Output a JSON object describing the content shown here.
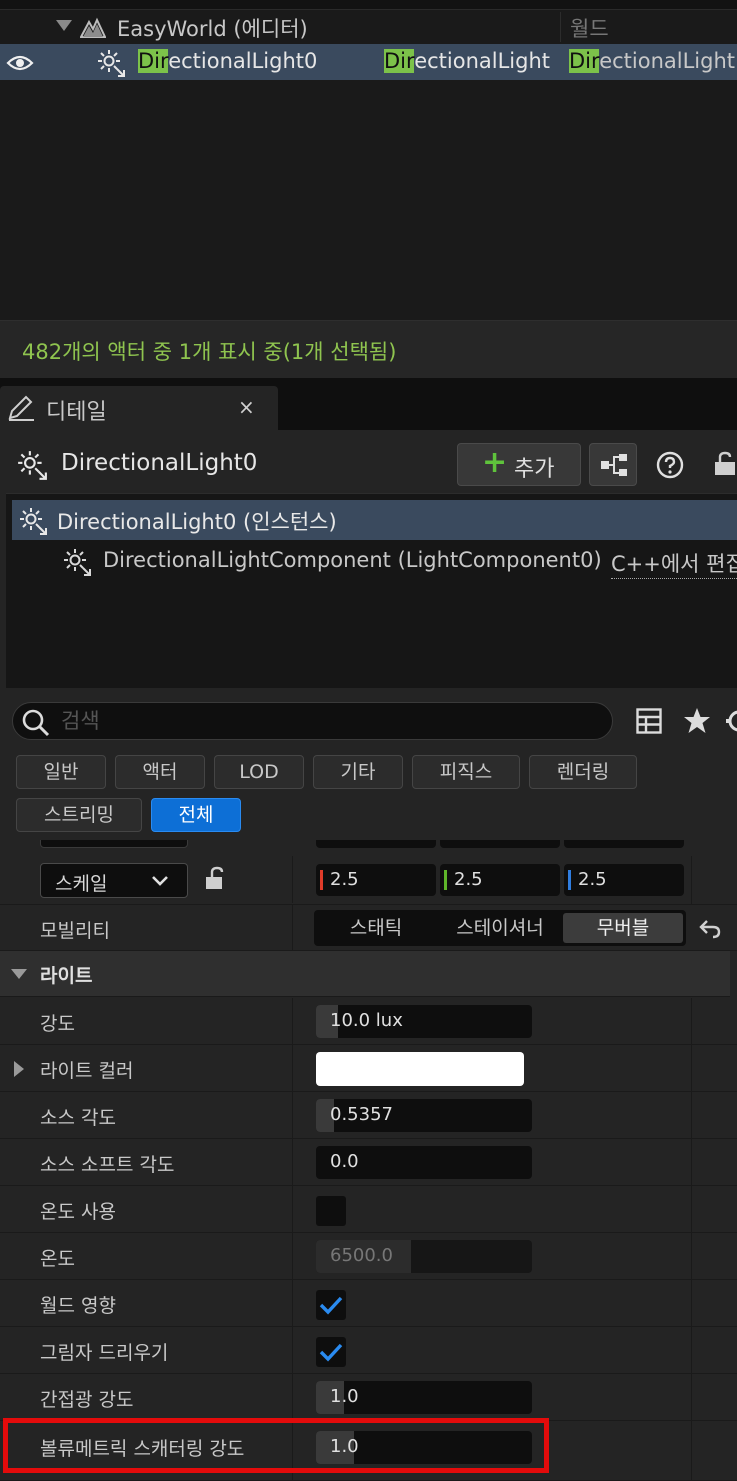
{
  "outliner": {
    "world_name": "EasyWorld (에디터)",
    "world_type": "월드",
    "light_name_hl": "Dir",
    "light_name_rest": "ectionalLight0",
    "light_type_hl": "Dir",
    "light_type_rest": "ectionalLight",
    "light_class_hl": "Dir",
    "light_class_rest": "ectionalLight",
    "status": "482개의 액터 중 1개 표시 중(1개 선택됨)"
  },
  "details": {
    "tab_label": "디테일",
    "tab_close": "×",
    "actor_name": "DirectionalLight0",
    "add_label": "추가",
    "add_plus": "+",
    "tree_instance": "DirectionalLight0 (인스턴스)",
    "tree_component": "DirectionalLightComponent (LightComponent0)",
    "tree_component_edit": "C++에서 편집",
    "search_placeholder": "검색",
    "filters": [
      "일반",
      "액터",
      "LOD",
      "기타",
      "피직스",
      "렌더링",
      "스트리밍",
      "전체"
    ],
    "active_filter": "전체"
  },
  "transform": {
    "scale_label": "스케일",
    "scale_x": "2.5",
    "scale_y": "2.5",
    "scale_z": "2.5"
  },
  "mobility": {
    "label": "모빌리티",
    "options": [
      "스태틱",
      "스테이셔너",
      "무버블"
    ],
    "selected": "무버블"
  },
  "light": {
    "category": "라이트",
    "intensity_label": "강도",
    "intensity_value": "10.0 lux",
    "color_label": "라이트 컬러",
    "color_value": "#ffffff",
    "source_angle_label": "소스 각도",
    "source_angle_value": "0.5357",
    "source_soft_angle_label": "소스 소프트 각도",
    "source_soft_angle_value": "0.0",
    "use_temp_label": "온도 사용",
    "use_temp_checked": false,
    "temp_label": "온도",
    "temp_value": "6500.0",
    "affects_world_label": "월드 영향",
    "affects_world_checked": true,
    "cast_shadows_label": "그림자 드리우기",
    "cast_shadows_checked": true,
    "indirect_label": "간접광 강도",
    "indirect_value": "1.0",
    "volumetric_label": "볼류메트릭 스캐터링 강도",
    "volumetric_value": "1.0"
  },
  "colors": {
    "selection": "#3a4a5e",
    "search_highlight": "#7cc24a",
    "status_text": "#8fc44f",
    "active_filter": "#0d6fd6",
    "check": "#2a8bf0",
    "annotation_box": "#e30b0b"
  }
}
